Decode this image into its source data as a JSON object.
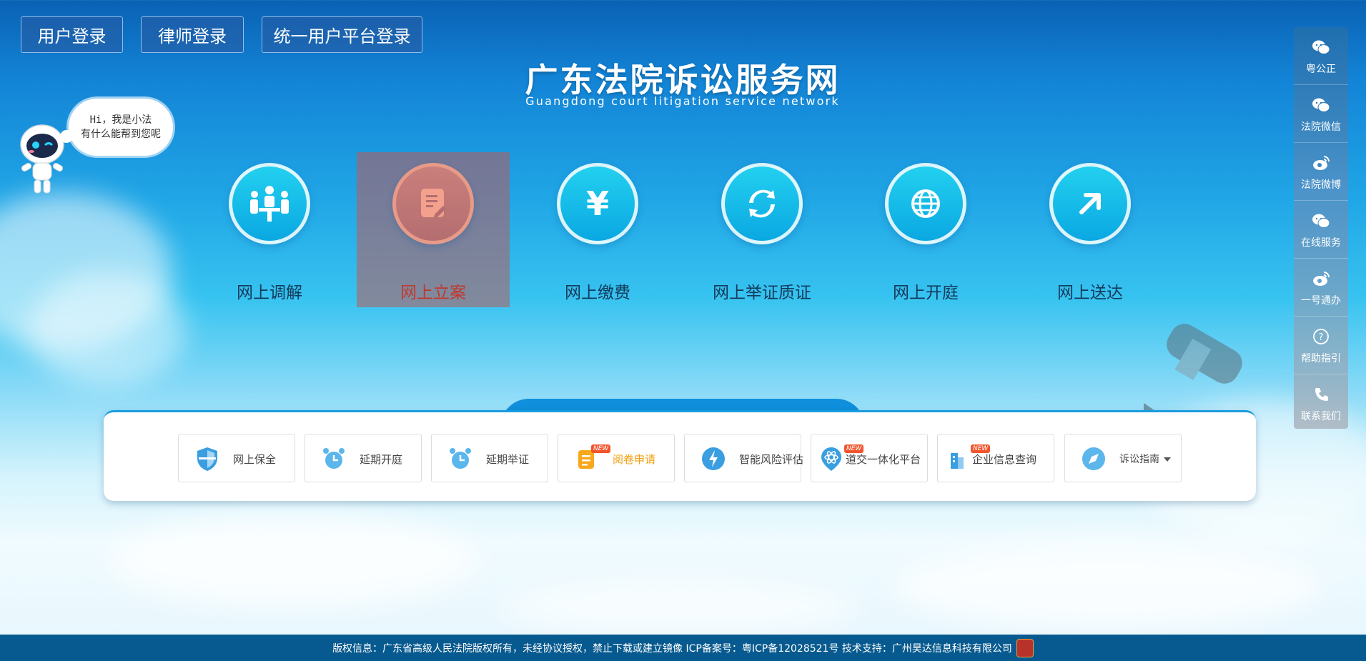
{
  "login": {
    "user": "用户登录",
    "lawyer": "律师登录",
    "unified": "统一用户平台登录"
  },
  "header": {
    "title": "广东法院诉讼服务网",
    "subtitle": "Guangdong court litigation service network"
  },
  "assistant": {
    "line1": "Hi，我是小法",
    "line2": "有什么能帮到您呢"
  },
  "services": [
    {
      "label": "网上调解",
      "icon": "meeting-icon",
      "active": false
    },
    {
      "label": "网上立案",
      "icon": "document-edit-icon",
      "active": true
    },
    {
      "label": "网上缴费",
      "icon": "yuan-icon",
      "active": false
    },
    {
      "label": "网上举证质证",
      "icon": "exchange-icon",
      "active": false
    },
    {
      "label": "网上开庭",
      "icon": "globe-icon",
      "active": false
    },
    {
      "label": "网上送达",
      "icon": "arrow-up-right-icon",
      "active": false
    }
  ],
  "tools": [
    {
      "label": "网上保全",
      "icon": "shield-icon"
    },
    {
      "label": "延期开庭",
      "icon": "alarm-clock-icon"
    },
    {
      "label": "延期举证",
      "icon": "alarm-clock-icon"
    },
    {
      "label": "阅卷申请",
      "icon": "file-list-icon",
      "badge": "NEW"
    },
    {
      "label": "智能风险评估",
      "icon": "lightning-icon"
    },
    {
      "label": "道交一体化平台",
      "icon": "atom-pin-icon",
      "badge": "NEW"
    },
    {
      "label": "企业信息查询",
      "icon": "building-icon",
      "badge": "NEW"
    },
    {
      "label": "诉讼指南",
      "icon": "compass-icon"
    }
  ],
  "sidebar": [
    {
      "label": "粤公正",
      "icon": "wechat-icon"
    },
    {
      "label": "法院微信",
      "icon": "wechat-icon"
    },
    {
      "label": "法院微博",
      "icon": "weibo-icon"
    },
    {
      "label": "在线服务",
      "icon": "wechat-icon"
    },
    {
      "label": "一号通办",
      "icon": "weibo-icon"
    },
    {
      "label": "帮助指引",
      "icon": "help-icon"
    },
    {
      "label": "联系我们",
      "icon": "phone-icon"
    }
  ],
  "footer": {
    "text": "版权信息：广东省高级人民法院版权所有，未经协议授权，禁止下载或建立镜像 ICP备案号：粤ICP备12028521号 技术支持：广州昊达信息科技有限公司"
  },
  "colors": {
    "accent": "#0f8fdc",
    "active": "#c0392b",
    "highlight": "#f0a010",
    "footer": "#075a8f"
  }
}
